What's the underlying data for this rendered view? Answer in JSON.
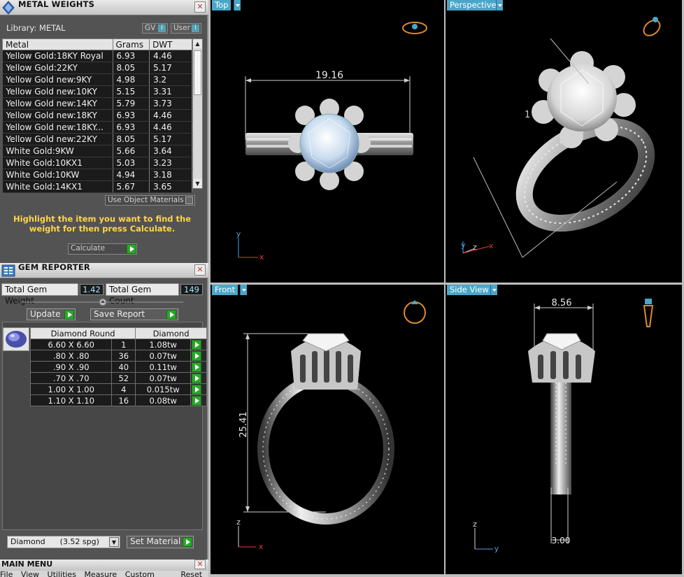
{
  "metal_weights": {
    "title": "METAL WEIGHTS",
    "library_label": "Library: METAL",
    "gv_label": "GV",
    "user_label": "User",
    "columns": [
      "Metal",
      "Grams",
      "DWT"
    ],
    "rows": [
      {
        "metal": "Yellow Gold:18KY Royal",
        "grams": "6.93",
        "dwt": "4.46"
      },
      {
        "metal": "Yellow Gold:22KY",
        "grams": "8.05",
        "dwt": "5.17"
      },
      {
        "metal": "Yellow Gold new:9KY",
        "grams": "4.98",
        "dwt": "3.2"
      },
      {
        "metal": "Yellow Gold new:10KY",
        "grams": "5.15",
        "dwt": "3.31"
      },
      {
        "metal": "Yellow Gold new:14KY",
        "grams": "5.79",
        "dwt": "3.73"
      },
      {
        "metal": "Yellow Gold new:18KY",
        "grams": "6.93",
        "dwt": "4.46"
      },
      {
        "metal": "Yellow Gold new:18KY...",
        "grams": "6.93",
        "dwt": "4.46"
      },
      {
        "metal": "Yellow Gold new:22KY",
        "grams": "8.05",
        "dwt": "5.17"
      },
      {
        "metal": "White Gold:9KW",
        "grams": "5.66",
        "dwt": "3.64"
      },
      {
        "metal": "White Gold:10KX1",
        "grams": "5.03",
        "dwt": "3.23"
      },
      {
        "metal": "White Gold:10KW",
        "grams": "4.94",
        "dwt": "3.18"
      },
      {
        "metal": "White Gold:14KX1",
        "grams": "5.67",
        "dwt": "3.65"
      }
    ],
    "use_object_materials": "Use Object Materials",
    "hint": "Highlight the item you want to find the weight for then press Calculate.",
    "calculate_label": "Calculate"
  },
  "gem_reporter": {
    "title": "GEM REPORTER",
    "total_weight_label": "Total Gem Weight",
    "total_weight_value": "1.42",
    "total_count_label": "Total Gem Count",
    "total_count_value": "149",
    "update_label": "Update",
    "save_report_label": "Save Report",
    "columns": [
      "Diamond Round",
      "Diamond"
    ],
    "rows": [
      {
        "size": "6.60 X 6.60",
        "count": "1",
        "weight": "1.08tw"
      },
      {
        "size": ".80 X .80",
        "count": "36",
        "weight": "0.07tw"
      },
      {
        "size": ".90 X .90",
        "count": "40",
        "weight": "0.11tw"
      },
      {
        "size": ".70 X .70",
        "count": "52",
        "weight": "0.07tw"
      },
      {
        "size": "1.00 X 1.00",
        "count": "4",
        "weight": "0.015tw"
      },
      {
        "size": "1.10 X 1.10",
        "count": "16",
        "weight": "0.08tw"
      }
    ],
    "material_select": "Diamond      (3.52 spg)",
    "set_material_label": "Set Material"
  },
  "main_menu": {
    "title": "MAIN MENU",
    "items": [
      "File",
      "View",
      "Utilities",
      "Measure",
      "Custom",
      "Reset"
    ]
  },
  "viewports": {
    "top": {
      "label": "Top",
      "dimension": "19.16",
      "axis_a": "y",
      "axis_b": "x"
    },
    "perspective": {
      "label": "Perspective",
      "dimension": "1",
      "axis_a": "y",
      "axis_b": "z",
      "axis_c": "x"
    },
    "front": {
      "label": "Front",
      "dimension": "25.41",
      "axis_a": "z",
      "axis_b": "x"
    },
    "side": {
      "label": "Side View",
      "dimension_top": "8.56",
      "dimension_bottom": "3.00",
      "axis_a": "z",
      "axis_b": "y"
    }
  },
  "colors": {
    "panel_bg": "#535353",
    "viewport_bg": "#000000",
    "tab_blue": "#4aa6c8",
    "hint_yellow": "#ffd54a",
    "value_cyan": "#9ee7ff",
    "axis_x": "#e23b3b",
    "axis_y": "#4f9fe8",
    "axis_z": "#d9d9d9",
    "go_green": "#29a829"
  }
}
